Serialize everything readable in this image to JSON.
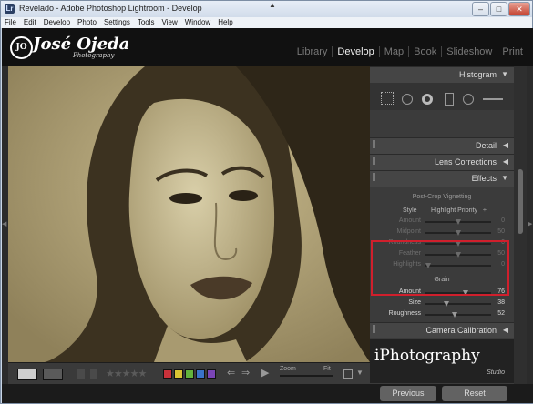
{
  "window": {
    "title": "Revelado - Adobe Photoshop Lightroom - Develop",
    "app_icon": "Lr",
    "minimize": "–",
    "maximize": "□",
    "close": "✕"
  },
  "menu": [
    "File",
    "Edit",
    "Develop",
    "Photo",
    "Settings",
    "Tools",
    "View",
    "Window",
    "Help"
  ],
  "identity": {
    "badge": "JO",
    "name": "José Ojeda",
    "subtitle": "Photography"
  },
  "modules": [
    "Library",
    "Develop",
    "Map",
    "Book",
    "Slideshow",
    "Print"
  ],
  "active_module": "Develop",
  "panels": {
    "histogram": "Histogram",
    "detail": "Detail",
    "lens": "Lens Corrections",
    "effects": "Effects",
    "camera": "Camera Calibration"
  },
  "vignetting": {
    "heading": "Post-Crop Vignetting",
    "style_label": "Style",
    "style_value": "Highlight Priority",
    "sliders": [
      {
        "label": "Amount",
        "value": "0",
        "pos": 0.5
      },
      {
        "label": "Midpoint",
        "value": "50",
        "pos": 0.5
      },
      {
        "label": "Roundness",
        "value": "0",
        "pos": 0.5
      },
      {
        "label": "Feather",
        "value": "50",
        "pos": 0.5
      },
      {
        "label": "Highlights",
        "value": "0",
        "pos": 0.05
      }
    ]
  },
  "grain": {
    "heading": "Grain",
    "sliders": [
      {
        "label": "Amount",
        "value": "76",
        "pos": 0.62
      },
      {
        "label": "Size",
        "value": "38",
        "pos": 0.33
      },
      {
        "label": "Roughness",
        "value": "52",
        "pos": 0.45
      }
    ]
  },
  "branding": {
    "main": "iPhotography",
    "sub": "Studio"
  },
  "buttons": {
    "previous": "Previous",
    "reset": "Reset"
  },
  "toolbar": {
    "stars": "★★★★★",
    "zoom": "Zoom",
    "fit": "Fit",
    "label_colors": [
      "#c8313a",
      "#d8c333",
      "#63b33c",
      "#3a73c9",
      "#7a45b6"
    ]
  },
  "colors": {
    "photo_tone": "#b7a77a",
    "highlight_box": "#d01f2c"
  }
}
